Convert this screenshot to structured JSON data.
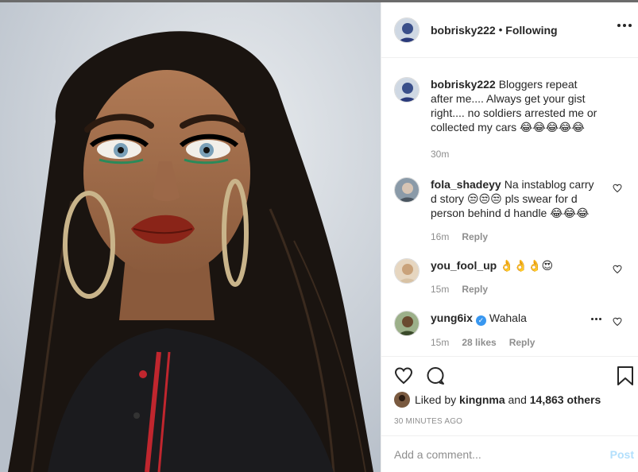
{
  "post": {
    "username": "bobrisky222",
    "separator": "•",
    "follow_status": "Following"
  },
  "caption": {
    "username": "bobrisky222",
    "text": "Bloggers repeat after me.... Always get your gist right.... no soldiers arrested me or collected my cars 😂😂😂😂😂",
    "time": "30m"
  },
  "comments": [
    {
      "username": "fola_shadeyy",
      "text": "Na instablog carry d story 😒😒😒 pls swear for d person behind d handle 😂😂😂",
      "time": "16m",
      "reply": "Reply"
    },
    {
      "username": "you_fool_up",
      "text": "👌👌👌😍",
      "time": "15m",
      "reply": "Reply"
    },
    {
      "username": "yung6ix",
      "verified_mark": "✓",
      "text": "Wahala",
      "time": "15m",
      "likes": "28 likes",
      "reply": "Reply"
    }
  ],
  "likes": {
    "prefix": "Liked by",
    "user": "kingnma",
    "and": "and",
    "others": "14,863 others"
  },
  "timestamp": "30 MINUTES AGO",
  "comment_box": {
    "placeholder": "Add a comment...",
    "post_label": "Post"
  },
  "icons": [
    "more-options-icon",
    "heart-icon",
    "comment-icon",
    "bookmark-icon"
  ],
  "colors": {
    "link_blue": "#3897f0",
    "post_disabled": "#b2dffc",
    "muted": "#8e8e8e"
  }
}
